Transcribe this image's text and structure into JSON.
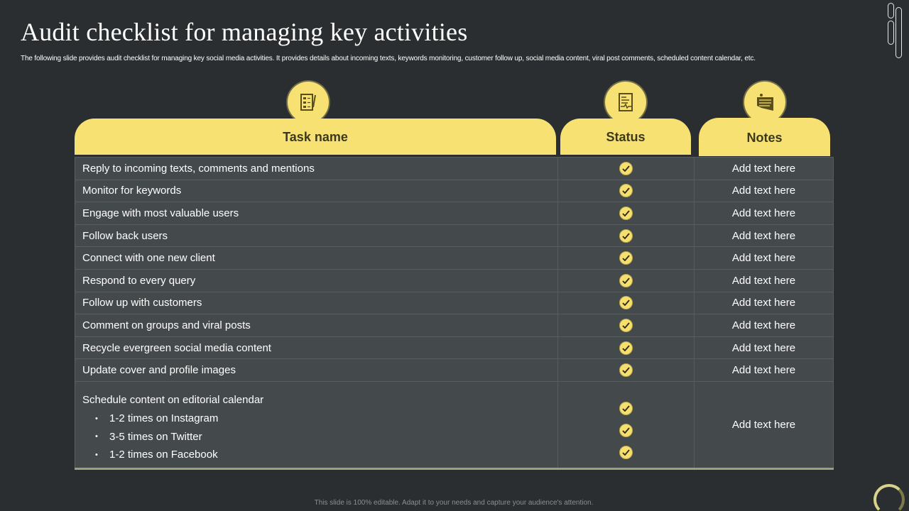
{
  "slide": {
    "title": "Audit checklist for managing key activities",
    "subtitle": "The following slide provides audit checklist for managing key social media activities. It provides details about incoming texts, keywords monitoring, customer follow up, social media  content, viral post comments, scheduled content calendar, etc.",
    "footer": "This slide is 100% editable.  Adapt it to your needs and capture your audience's attention."
  },
  "colors": {
    "background": "#2a2e30",
    "accent": "#f7e172",
    "row_background": "#444a4c",
    "header_text": "#3b3a1e"
  },
  "table": {
    "headers": {
      "task": "Task name",
      "status": "Status",
      "notes": "Notes"
    },
    "header_icons": {
      "task": "checklist-icon",
      "status": "report-document-icon",
      "notes": "note-board-icon"
    },
    "rows": [
      {
        "task": "Reply to incoming texts, comments and mentions",
        "status": "done",
        "notes": "Add text here"
      },
      {
        "task": "Monitor for keywords",
        "status": "done",
        "notes": "Add text here"
      },
      {
        "task": "Engage with most valuable users",
        "status": "done",
        "notes": "Add text here"
      },
      {
        "task": "Follow back users",
        "status": "done",
        "notes": "Add text here"
      },
      {
        "task": "Connect with one new client",
        "status": "done",
        "notes": "Add text here"
      },
      {
        "task": "Respond to every query",
        "status": "done",
        "notes": "Add text here"
      },
      {
        "task": "Follow up with customers",
        "status": "done",
        "notes": "Add text here"
      },
      {
        "task": "Comment on groups and viral posts",
        "status": "done",
        "notes": "Add text here"
      },
      {
        "task": "Recycle evergreen social media content",
        "status": "done",
        "notes": "Add text here"
      },
      {
        "task": "Update cover and profile images",
        "status": "done",
        "notes": "Add text here"
      }
    ],
    "last_row": {
      "task": "Schedule content on editorial calendar",
      "subitems": [
        {
          "text": "1-2 times on Instagram",
          "status": "done"
        },
        {
          "text": "3-5 times on Twitter",
          "status": "done"
        },
        {
          "text": "1-2 times on Facebook",
          "status": "done"
        }
      ],
      "notes": "Add text here"
    }
  }
}
